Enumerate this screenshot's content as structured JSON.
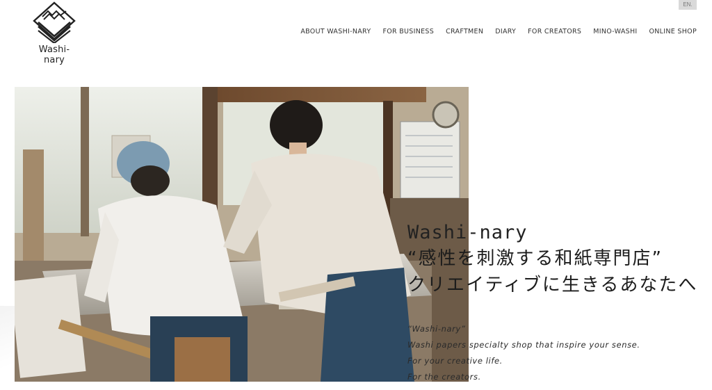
{
  "header": {
    "logo_text": "Washi-nary",
    "lang_button": "EN.",
    "nav": [
      {
        "label": "ABOUT WASHI-NARY"
      },
      {
        "label": "FOR BUSINESS"
      },
      {
        "label": "CRAFTMEN"
      },
      {
        "label": "DIARY"
      },
      {
        "label": "FOR CREATORS"
      },
      {
        "label": "MINO-WASHI"
      },
      {
        "label": "ONLINE SHOP"
      }
    ]
  },
  "hero": {
    "title": "Washi-nary",
    "jp_line_1": "“感性を刺激する和紙専門店”",
    "jp_line_2": "クリエイティブに生きるあなたへ",
    "sub_lines": [
      "“Washi-nary”",
      "Washi papers specialty shop that inspire your sense.",
      "For your creative life.",
      "For the creators."
    ]
  },
  "colors": {
    "background": "#ffffff",
    "text": "#222222",
    "lang_bg": "#d9d9d9"
  }
}
